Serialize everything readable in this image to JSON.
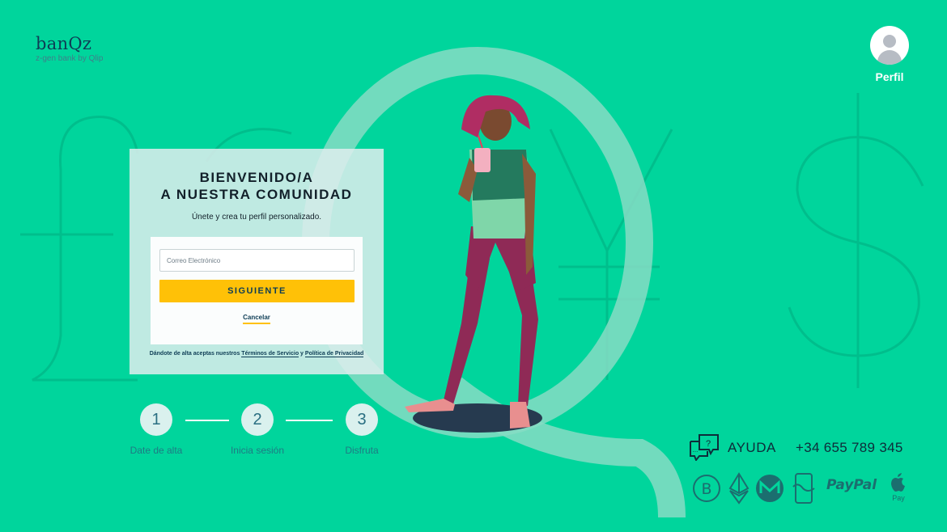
{
  "brand": {
    "name": "banQz",
    "tagline": "z-gen bank by Qlip"
  },
  "profile": {
    "label": "Perfil"
  },
  "card": {
    "title_line1": "BIENVENIDO/A",
    "title_line2": "A NUESTRA COMUNIDAD",
    "subtitle": "Únete y crea tu perfil personalizado.",
    "email_placeholder": "Correo Electrónico",
    "email_value": "",
    "next_button": "SIGUIENTE",
    "cancel_link": "Cancelar",
    "terms_prefix": "Dándote de alta aceptas nuestros ",
    "terms_link": "Términos de Servicio",
    "terms_and": " y ",
    "privacy_link": "Política de Privacidad"
  },
  "steps": [
    {
      "number": "1",
      "label": "Date de alta"
    },
    {
      "number": "2",
      "label": "Inicia sesión"
    },
    {
      "number": "3",
      "label": "Disfruta"
    }
  ],
  "footer": {
    "help_label": "AYUDA",
    "phone": "+34 655 789 345",
    "payment_methods": [
      "bitcoin-icon",
      "ethereum-icon",
      "monero-icon",
      "bizum-icon",
      "PayPal",
      "apple-pay-icon"
    ],
    "paypal_label": "PayPal",
    "apple_pay_label": "Pay"
  },
  "colors": {
    "background": "#00d59c",
    "accent_yellow": "#ffc107",
    "text_dark": "#0e3d55",
    "watermark": "#00c08d"
  }
}
